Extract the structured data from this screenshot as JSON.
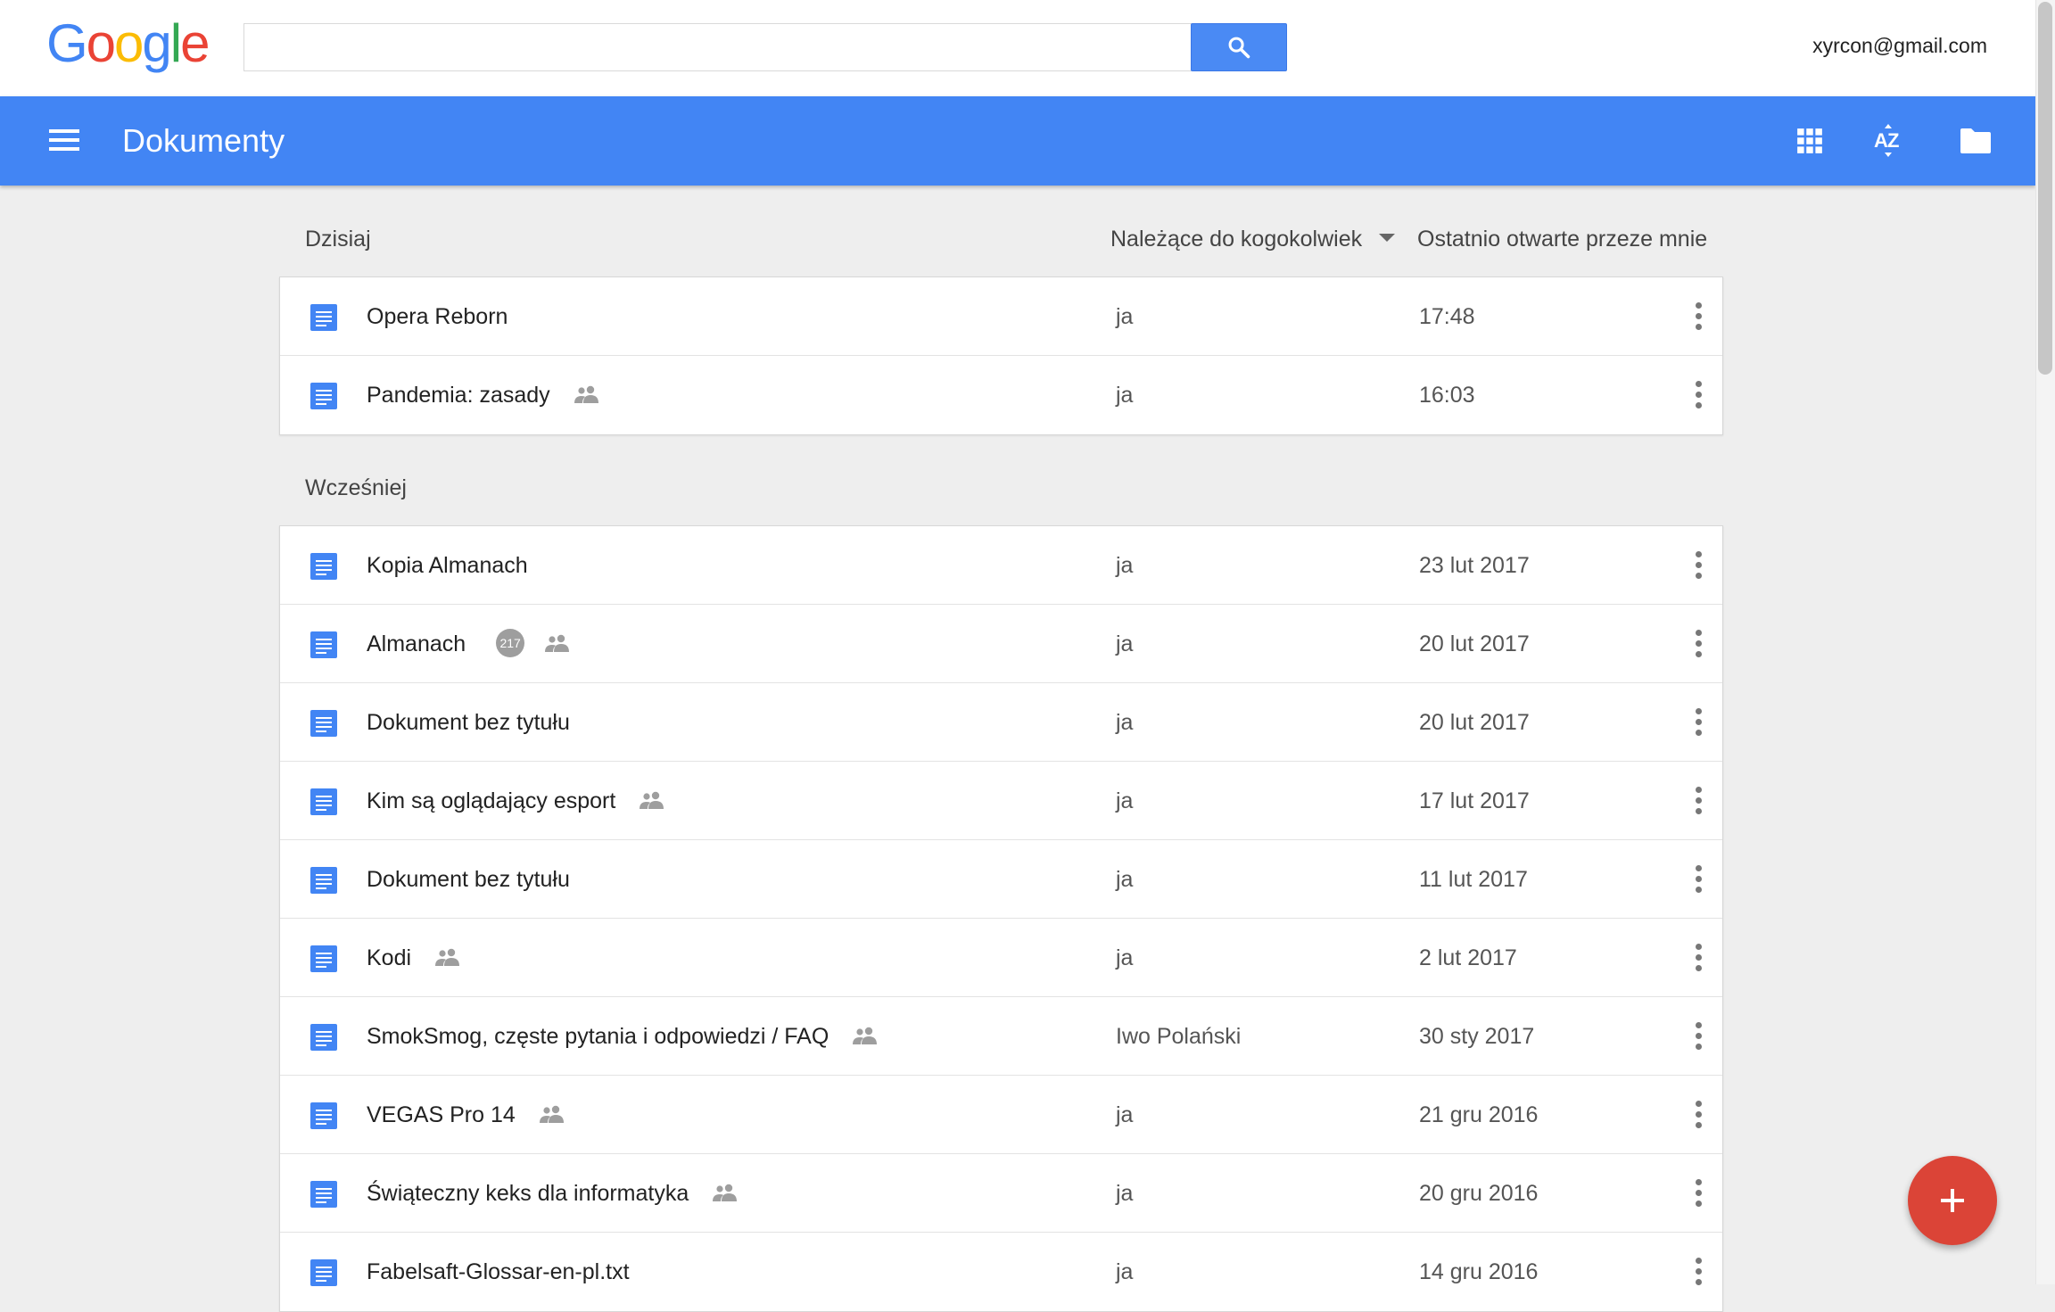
{
  "google_bar": {
    "logo_letters": [
      "G",
      "o",
      "o",
      "g",
      "l",
      "e"
    ],
    "logo_colors": [
      "#4285f4",
      "#ea4335",
      "#fbbc05",
      "#4285f4",
      "#34a853",
      "#ea4335"
    ],
    "search_value": "",
    "search_icon": "search-icon",
    "account": "xyrcon@gmail.com"
  },
  "app_bar": {
    "menu_icon": "hamburger-menu-icon",
    "title": "Dokumenty",
    "actions": [
      "grid-view-icon",
      "sort-az-icon",
      "folder-icon"
    ],
    "color": "#4285f4"
  },
  "columns": {
    "owner": "Należące do kogokolwiek",
    "date": "Ostatnio otwarte przeze mnie"
  },
  "today": {
    "label": "Dzisiaj",
    "rows": [
      {
        "name": "Opera Reborn",
        "shared": false,
        "badge": "",
        "owner": "ja",
        "date": "17:48"
      },
      {
        "name": "Pandemia: zasady",
        "shared": true,
        "badge": "",
        "owner": "ja",
        "date": "16:03"
      }
    ]
  },
  "earlier": {
    "label": "Wcześniej",
    "rows": [
      {
        "name": "Kopia Almanach",
        "shared": false,
        "badge": "",
        "owner": "ja",
        "date": "23 lut 2017"
      },
      {
        "name": "Almanach",
        "shared": true,
        "badge": "217",
        "owner": "ja",
        "date": "20 lut 2017"
      },
      {
        "name": "Dokument bez tytułu",
        "shared": false,
        "badge": "",
        "owner": "ja",
        "date": "20 lut 2017"
      },
      {
        "name": "Kim są oglądający esport",
        "shared": true,
        "badge": "",
        "owner": "ja",
        "date": "17 lut 2017"
      },
      {
        "name": "Dokument bez tytułu",
        "shared": false,
        "badge": "",
        "owner": "ja",
        "date": "11 lut 2017"
      },
      {
        "name": "Kodi",
        "shared": true,
        "badge": "",
        "owner": "ja",
        "date": "2 lut 2017"
      },
      {
        "name": "SmokSmog, częste pytania i odpowiedzi / FAQ",
        "shared": true,
        "badge": "",
        "owner": "Iwo Polański",
        "date": "30 sty 2017"
      },
      {
        "name": "VEGAS Pro 14",
        "shared": true,
        "badge": "",
        "owner": "ja",
        "date": "21 gru 2016"
      },
      {
        "name": "Świąteczny keks dla informatyka",
        "shared": true,
        "badge": "",
        "owner": "ja",
        "date": "20 gru 2016"
      },
      {
        "name": "Fabelsaft-Glossar-en-pl.txt",
        "shared": false,
        "badge": "",
        "owner": "ja",
        "date": "14 gru 2016"
      }
    ]
  },
  "fab": {
    "icon": "plus-icon",
    "color": "#db4437"
  }
}
